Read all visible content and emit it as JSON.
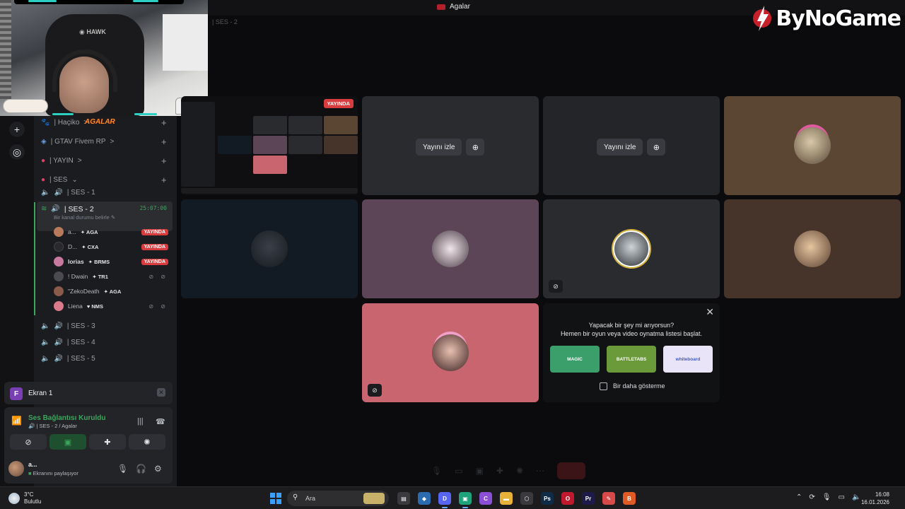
{
  "window": {
    "title": "Agalar",
    "brand": "ByNoGame"
  },
  "stage": {
    "faint_channel": "SES - 2"
  },
  "sidebar": {
    "overlay_label": "AGALAR",
    "channels": [
      {
        "name": "| Haçiko",
        "suffix": ">"
      },
      {
        "name": "| GTAV Fivem RP",
        "suffix": ">"
      },
      {
        "name": "| YAYIN",
        "suffix": ">"
      },
      {
        "name": "| SES",
        "suffix": "⌄"
      }
    ],
    "voice_channels": [
      {
        "name": "| SES - 1"
      },
      {
        "name": "| SES - 2",
        "timer": "25:07:00",
        "status": "Bir kanal durumu belirle"
      },
      {
        "name": "| SES - 3"
      },
      {
        "name": "| SES - 4"
      },
      {
        "name": "| SES - 5"
      }
    ],
    "members": [
      {
        "name": "a...",
        "tag": "AGA",
        "live": "YAYINDA",
        "color": "#b97a5c"
      },
      {
        "name": "D...",
        "tag": "CXA",
        "live": "YAYINDA",
        "color": "#2a2a2e"
      },
      {
        "name": "lorias",
        "tag": "BRMS",
        "live": "YAYINDA",
        "color": "#c77aa0"
      },
      {
        "name": "! Dwain",
        "tag": "TR1",
        "muted": "⊘ ⊘",
        "color": "#4a4a50"
      },
      {
        "name": "\"ZekoDeath",
        "tag": "AGA",
        "color": "#8a5a4a"
      },
      {
        "name": "Liena",
        "tag": "NMS",
        "muted": "⊘ ⊘",
        "color": "#d87a8a"
      }
    ]
  },
  "panels": {
    "screen_share": {
      "initial": "F",
      "label": "Ekran 1"
    },
    "voice": {
      "status": "Ses Bağlantısı Kuruldu",
      "channel": "| SES - 2 / Agalar"
    },
    "user": {
      "name": "a...",
      "status": "Ekranını paylaşıyor"
    }
  },
  "tiles": {
    "live_badge": "YAYINDA",
    "watch_label": "Yayını izle",
    "colors": {
      "mid_gray": "#2a2b2f",
      "brown": "#5a4633",
      "navy": "#121a24",
      "mauve": "#5b4556",
      "dark_gray": "#2a2b2f",
      "dark_brown": "#46342a",
      "pink": "#c9656f"
    }
  },
  "activity": {
    "line1": "Yapacak bir şey mi arıyorsun?",
    "line2": "Hemen bir oyun veya video oynatma listesi başlat.",
    "checkbox_label": "Bir daha gösterme",
    "cards": [
      {
        "label": "MAGIC",
        "color": "#3a9f6a"
      },
      {
        "label": "BATTLETABS",
        "color": "#6a9a3a"
      },
      {
        "label": "whiteboard",
        "color": "#e9e4f7"
      }
    ]
  },
  "taskbar": {
    "weather_temp": "3°C",
    "weather_desc": "Bulutlu",
    "search_placeholder": "Ara",
    "time": "16:08",
    "date": "16.01.2026",
    "apps": [
      {
        "label": "▤",
        "color": "#3a3a3e"
      },
      {
        "label": "◆",
        "color": "#2b6cb0"
      },
      {
        "label": "D",
        "color": "#5865f2"
      },
      {
        "label": "▣",
        "color": "#1fa37a"
      },
      {
        "label": "C",
        "color": "#8a4fd6"
      },
      {
        "label": "▬",
        "color": "#e8b23a"
      },
      {
        "label": "⬡",
        "color": "#3a3a3e"
      },
      {
        "label": "Ps",
        "color": "#0f2b45"
      },
      {
        "label": "O",
        "color": "#c0192d"
      },
      {
        "label": "Pr",
        "color": "#1e1a4a"
      },
      {
        "label": "✎",
        "color": "#d84a4a"
      },
      {
        "label": "B",
        "color": "#e05a24"
      }
    ]
  }
}
